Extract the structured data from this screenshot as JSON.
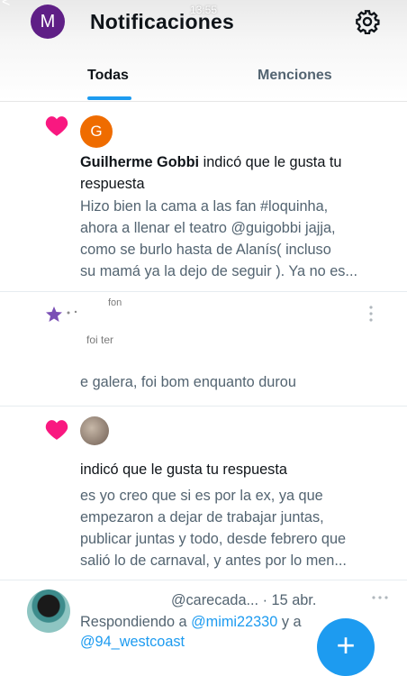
{
  "status": {
    "time": "13:55"
  },
  "header": {
    "avatar_letter": "M",
    "title": "Notificaciones"
  },
  "tabs": [
    {
      "label": "Todas"
    },
    {
      "label": "Menciones"
    }
  ],
  "notif1": {
    "avatar_letter": "G",
    "user": "Guilherme Gobbi",
    "action_1": " indicó que le gusta tu",
    "action_2": "respuesta",
    "text": [
      "Hizo bien la cama a las fan #loquinha,",
      "ahora a llenar el teatro @guigobbi jajja,",
      "como se burlo hasta de Alanís( incluso",
      "su mamá ya la dejo de seguir ). Ya no es..."
    ]
  },
  "notif2": {
    "fragments": [
      "fon",
      "foi ter"
    ],
    "text": "e galera, foi bom enquanto durou"
  },
  "notif3": {
    "action": "indicó que le gusta tu respuesta",
    "text": [
      "es yo creo que si es por la ex, ya que",
      "empezaron a dejar de trabajar juntas,",
      "publicar juntas y todo, desde febrero que",
      "salió lo de carnaval, y antes por lo men..."
    ]
  },
  "tweet": {
    "handle": "@carecada...",
    "date": "· 15 abr.",
    "reply_prefix": "Respondiendo a ",
    "reply_user1": "@mimi22330",
    "reply_mid": " y a",
    "reply_user2": "@94_westcoast"
  },
  "colors": {
    "accent": "#1d9bf0",
    "heart": "#f91880",
    "avatar_purple": "#5f1f86",
    "avatar_orange": "#ef6c00"
  }
}
